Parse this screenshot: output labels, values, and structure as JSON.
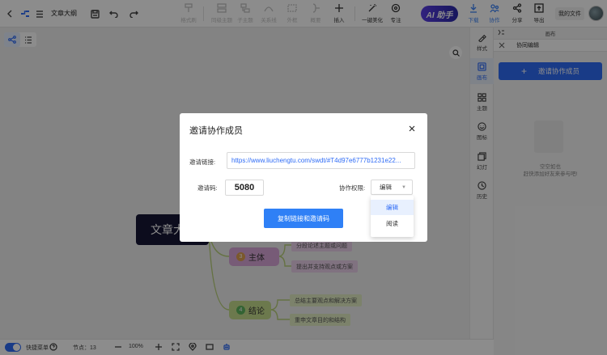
{
  "toolbar": {
    "doc_title": "文章大纲",
    "tools": [
      {
        "label": "格式刷",
        "icon": "format-brush-icon"
      },
      {
        "label": "同级主题",
        "icon": "sibling-topic-icon"
      },
      {
        "label": "子主题",
        "icon": "child-topic-icon"
      },
      {
        "label": "关系线",
        "icon": "relation-line-icon"
      },
      {
        "label": "外框",
        "icon": "boundary-icon"
      },
      {
        "label": "概要",
        "icon": "summary-icon"
      },
      {
        "label": "插入",
        "icon": "insert-icon"
      },
      {
        "label": "一键美化",
        "icon": "beautify-icon"
      },
      {
        "label": "专注",
        "icon": "focus-icon"
      }
    ],
    "ai_label": "AI 助手",
    "right_tools": [
      {
        "label": "下载",
        "icon": "download-icon"
      },
      {
        "label": "协作",
        "icon": "collaborate-icon"
      },
      {
        "label": "分享",
        "icon": "share-icon"
      },
      {
        "label": "导出",
        "icon": "export-icon"
      }
    ],
    "my_files": "我的文件"
  },
  "canvas": {
    "root": "文章大",
    "topics": [
      {
        "num": "3",
        "label": "主体",
        "color": "#d9a6d9",
        "num_color": "#e0a050"
      },
      {
        "num": "4",
        "label": "结论",
        "color": "#c5dc8c",
        "num_color": "#5eb55e"
      }
    ],
    "subtopics": [
      "分段论述主题或问题",
      "提出并支持观点或方案",
      "总结主要观点和解决方案",
      "重申文章目的和结构"
    ]
  },
  "statusbar": {
    "quick_theme": "快捷菜单",
    "node_count": "节点：13",
    "zoom": "100%"
  },
  "rail": {
    "items": [
      {
        "label": "样式",
        "icon": "style-icon"
      },
      {
        "label": "画布",
        "icon": "canvas-icon"
      },
      {
        "label": "主题",
        "icon": "theme-icon"
      },
      {
        "label": "图标",
        "icon": "emoji-icon"
      },
      {
        "label": "幻灯",
        "icon": "slides-icon"
      },
      {
        "label": "历史",
        "icon": "history-icon"
      }
    ]
  },
  "panel": {
    "header": "画布",
    "subheader": "协同编辑",
    "invite_button": "邀请协作成员",
    "empty_title": "空空如也",
    "empty_desc": "赶快添加好友来参与吧!"
  },
  "modal": {
    "title": "邀请协作成员",
    "link_label": "邀请链接:",
    "link_value": "https://www.liuchengtu.com/swdt/#T4d97e6777b1231e22...",
    "code_label": "邀请码:",
    "code_value": "5080",
    "perm_label": "协作权限:",
    "perm_value": "编辑",
    "perm_options": [
      "编辑",
      "阅读"
    ],
    "copy_button": "复制链接和邀请码"
  },
  "colors": {
    "accent": "#2f6cf6",
    "root_bg": "#171736",
    "ai_gradient_start": "#5b3ee6",
    "ai_gradient_end": "#2a2aa8"
  }
}
